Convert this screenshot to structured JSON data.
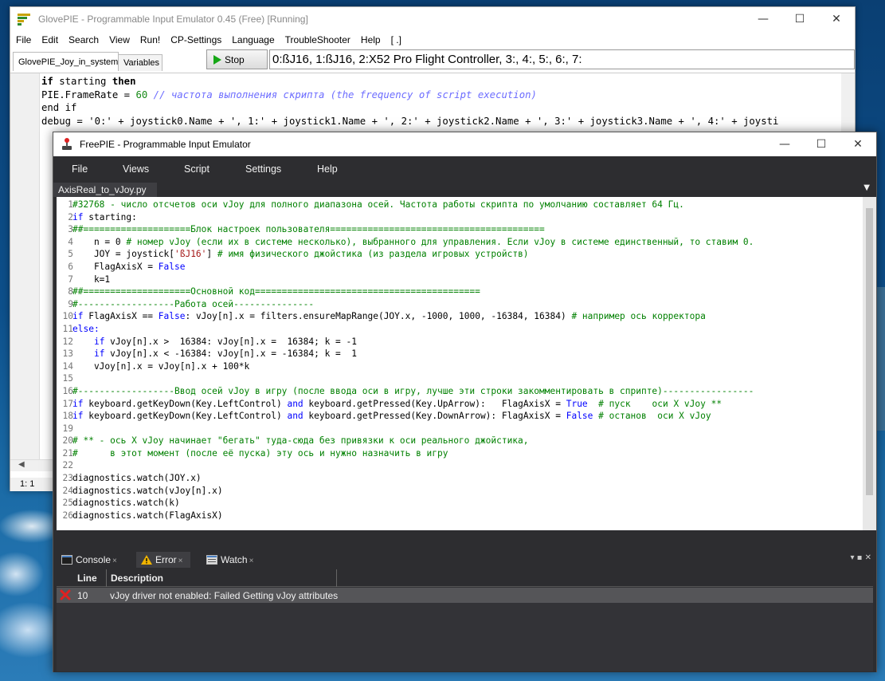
{
  "glovepie": {
    "title": "GlovePIE - Programmable Input Emulator 0.45 (Free) [Running]",
    "menu": [
      "File",
      "Edit",
      "Search",
      "View",
      "Run!",
      "CP-Settings",
      "Language",
      "TroubleShooter",
      "Help",
      "[ .]"
    ],
    "tabs": [
      "GlovePIE_Joy_in_system",
      "Variables"
    ],
    "stop_label": "Stop",
    "debug_output": "0:ßJ16, 1:ßJ16, 2:X52 Pro Flight Controller, 3:, 4:, 5:, 6:, 7:",
    "code": {
      "l1_kw1": "if",
      "l1_mid": " starting ",
      "l1_kw2": "then",
      "l2_a": "PIE.FrameRate = ",
      "l2_num": "60",
      "l2_cm": " // частота выполнения скрипта (the frequency of script execution)",
      "l3": "end if",
      "l4": "debug = '0:' + joystick0.Name + ', 1:' + joystick1.Name + ', 2:' + joystick2.Name + ', 3:' + joystick3.Name + ', 4:' + joysti"
    },
    "status": "1: 1"
  },
  "freepie": {
    "title": "FreePIE - Programmable Input Emulator",
    "menu": [
      "File",
      "Views",
      "Script",
      "Settings",
      "Help"
    ],
    "doc_tab": "AxisReal_to_vJoy.py",
    "doc_tab_close": "×",
    "line_numbers": "1\n2\n3\n4\n5\n6\n7\n8\n9\n10\n11\n12\n13\n14\n15\n16\n17\n18\n19\n20\n21\n22\n23\n24\n25\n26",
    "code": {
      "l1": "#32768 - число отсчетов оси vJoy для полного диапазона осей. Частота работы скрипта по умолчанию составляет 64 Гц.",
      "l2_kw": "if",
      "l2_rest": " starting:",
      "l3": "##====================Блок настроек пользователя========================================",
      "l4_a": "    n = 0 ",
      "l4_c": "# номер vJoy (если их в системе несколько), выбранного для управления. Если vJoy в системе единственный, то ставим 0.",
      "l5_a": "    JOY = joystick[",
      "l5_s": "'ßJ16'",
      "l5_b": "] ",
      "l5_c": "# имя физического джойстика (из раздела игровых устройств)",
      "l6_a": "    FlagAxisX = ",
      "l6_k": "False",
      "l7": "    k=1",
      "l8": "##====================Основной код==========================================",
      "l9": "#------------------Работа осей---------------",
      "l10_k1": "if",
      "l10_a": " FlagAxisX == ",
      "l10_k2": "False",
      "l10_b": ": vJoy[n].x = filters.",
      "l10_f": "ensureMapRange",
      "l10_c": "(JOY.x, -1000, 1000, -16384, 16384) ",
      "l10_cm": "# например ось корректора",
      "l11": "else:",
      "l12_a": "    ",
      "l12_k": "if",
      "l12_b": " vJoy[n].x >  16384: vJoy[n].x =  16384; k = -1",
      "l13_a": "    ",
      "l13_k": "if",
      "l13_b": " vJoy[n].x < -16384: vJoy[n].x = -16384; k =  1",
      "l14": "    vJoy[n].x = vJoy[n].x + 100*k",
      "l16": "#------------------Ввод осей vJoy в игру (после ввода оси в игру, лучше эти строки закомментировать в сприпте)-----------------",
      "l17_k1": "if",
      "l17_a": " keyboard.",
      "l17_f1": "getKeyDown",
      "l17_b": "(Key.LeftControl) ",
      "l17_k2": "and",
      "l17_c": " keyboard.",
      "l17_f2": "getPressed",
      "l17_d": "(Key.UpArrow):   FlagAxisX = ",
      "l17_k3": "True",
      "l17_cm": "  # пуск    оси X vJoy **",
      "l18_k1": "if",
      "l18_a": " keyboard.",
      "l18_f1": "getKeyDown",
      "l18_b": "(Key.LeftControl) ",
      "l18_k2": "and",
      "l18_c": " keyboard.",
      "l18_f2": "getPressed",
      "l18_d": "(Key.DownArrow): FlagAxisX = ",
      "l18_k3": "False",
      "l18_cm": " # останов  оси X vJoy",
      "l20": "# ** - ось X vJoy начинает \"бегать\" туда-сюда без привязки к оси реального джойстика,",
      "l21": "#      в этот момент (после её пуска) эту ось и нужно назначить в игру",
      "l23_a": "diagnostics.",
      "l23_f": "watch",
      "l23_b": "(JOY.x)",
      "l24_a": "diagnostics.",
      "l24_f": "watch",
      "l24_b": "(vJoy[n].x)",
      "l25_a": "diagnostics.",
      "l25_f": "watch",
      "l25_b": "(k)",
      "l26_a": "diagnostics.",
      "l26_f": "watch",
      "l26_b": "(FlagAxisX)"
    },
    "panel_tabs": [
      "Console",
      "Error",
      "Watch"
    ],
    "panel_tab_close": "×",
    "panel_controls": "▾ ▪ ✕",
    "error_table": {
      "headers": [
        "Line",
        "Description"
      ],
      "rows": [
        {
          "line": "10",
          "description": "vJoy driver not enabled: Failed Getting vJoy attributes"
        }
      ]
    }
  }
}
